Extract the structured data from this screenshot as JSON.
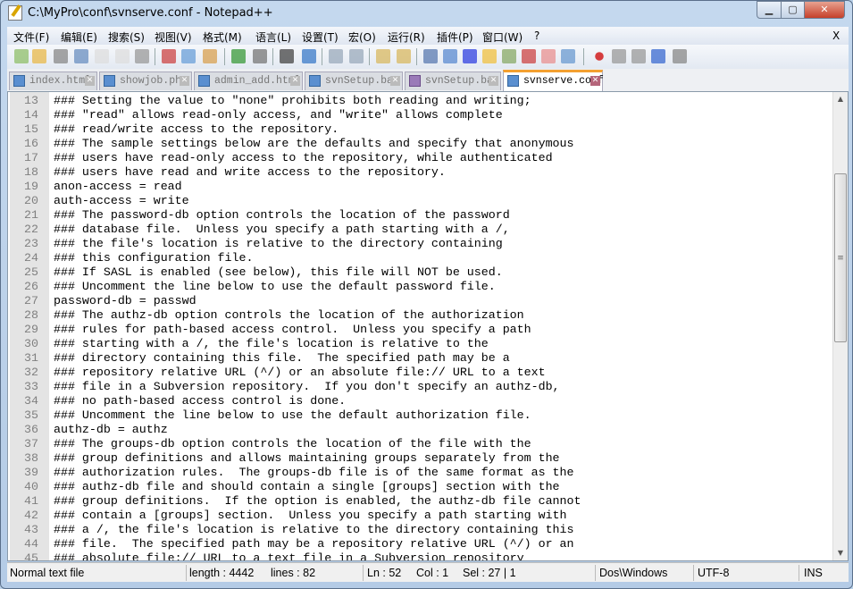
{
  "window": {
    "title": "C:\\MyPro\\conf\\svnserve.conf - Notepad++",
    "min": "▁",
    "max": "▢",
    "close": "✕"
  },
  "menu": {
    "items": [
      "文件(F)",
      "编辑(E)",
      "搜索(S)",
      "视图(V)",
      "格式(M)",
      "语言(L)",
      "设置(T)",
      "宏(O)",
      "运行(R)",
      "插件(P)",
      "窗口(W)",
      "?"
    ],
    "close": "X"
  },
  "toolbar": {
    "icons": [
      "new-icon",
      "open-icon",
      "save-icon",
      "save-all-icon",
      "close-icon",
      "close-all-icon",
      "print-icon",
      "cut-icon",
      "copy-icon",
      "paste-icon",
      "undo-icon",
      "redo-icon",
      "find-icon",
      "replace-icon",
      "zoom-in-icon",
      "zoom-out-icon",
      "sync-v-icon",
      "sync-h-icon",
      "word-wrap-icon",
      "show-all-chars-icon",
      "indent-guide-icon",
      "udl-icon",
      "doc-map-icon",
      "function-list-icon",
      "folder-workspace-icon",
      "monitor-icon",
      "record-macro-icon",
      "stop-macro-icon",
      "play-macro-icon",
      "run-macro-multiple-icon",
      "save-macro-icon"
    ]
  },
  "tabs": [
    {
      "label": "index.html",
      "active": false
    },
    {
      "label": "showjob.php",
      "active": false
    },
    {
      "label": "admin_add.html",
      "active": false
    },
    {
      "label": "svnSetup.bat",
      "active": false
    },
    {
      "label": "svnSetup.bat",
      "active": false
    },
    {
      "label": "svnserve.conf",
      "active": true
    }
  ],
  "editor": {
    "lines": [
      {
        "n": "13",
        "t": "### Setting the value to \"none\" prohibits both reading and writing;"
      },
      {
        "n": "14",
        "t": "### \"read\" allows read-only access, and \"write\" allows complete"
      },
      {
        "n": "15",
        "t": "### read/write access to the repository."
      },
      {
        "n": "16",
        "t": "### The sample settings below are the defaults and specify that anonymous"
      },
      {
        "n": "17",
        "t": "### users have read-only access to the repository, while authenticated"
      },
      {
        "n": "18",
        "t": "### users have read and write access to the repository."
      },
      {
        "n": "19",
        "t": "anon-access = read"
      },
      {
        "n": "20",
        "t": "auth-access = write"
      },
      {
        "n": "21",
        "t": "### The password-db option controls the location of the password"
      },
      {
        "n": "22",
        "t": "### database file.  Unless you specify a path starting with a /,"
      },
      {
        "n": "23",
        "t": "### the file's location is relative to the directory containing"
      },
      {
        "n": "24",
        "t": "### this configuration file."
      },
      {
        "n": "25",
        "t": "### If SASL is enabled (see below), this file will NOT be used."
      },
      {
        "n": "26",
        "t": "### Uncomment the line below to use the default password file."
      },
      {
        "n": "27",
        "t": "password-db = passwd"
      },
      {
        "n": "28",
        "t": "### The authz-db option controls the location of the authorization"
      },
      {
        "n": "29",
        "t": "### rules for path-based access control.  Unless you specify a path"
      },
      {
        "n": "30",
        "t": "### starting with a /, the file's location is relative to the"
      },
      {
        "n": "31",
        "t": "### directory containing this file.  The specified path may be a"
      },
      {
        "n": "32",
        "t": "### repository relative URL (^/) or an absolute file:// URL to a text"
      },
      {
        "n": "33",
        "t": "### file in a Subversion repository.  If you don't specify an authz-db,"
      },
      {
        "n": "34",
        "t": "### no path-based access control is done."
      },
      {
        "n": "35",
        "t": "### Uncomment the line below to use the default authorization file."
      },
      {
        "n": "36",
        "t": "authz-db = authz"
      },
      {
        "n": "37",
        "t": "### The groups-db option controls the location of the file with the"
      },
      {
        "n": "38",
        "t": "### group definitions and allows maintaining groups separately from the"
      },
      {
        "n": "39",
        "t": "### authorization rules.  The groups-db file is of the same format as the"
      },
      {
        "n": "40",
        "t": "### authz-db file and should contain a single [groups] section with the"
      },
      {
        "n": "41",
        "t": "### group definitions.  If the option is enabled, the authz-db file cannot"
      },
      {
        "n": "42",
        "t": "### contain a [groups] section.  Unless you specify a path starting with"
      },
      {
        "n": "43",
        "t": "### a /, the file's location is relative to the directory containing this"
      },
      {
        "n": "44",
        "t": "### file.  The specified path may be a repository relative URL (^/) or an"
      },
      {
        "n": "45",
        "t": "### absolute file:// URL to a text file in a Subversion repository"
      }
    ]
  },
  "status": {
    "type": "Normal text file",
    "length": "length : 4442",
    "lines": "lines : 82",
    "ln": "Ln : 52",
    "col": "Col : 1",
    "sel": "Sel : 27 | 1",
    "eol": "Dos\\Windows",
    "encoding": "UTF-8",
    "mode": "INS"
  }
}
